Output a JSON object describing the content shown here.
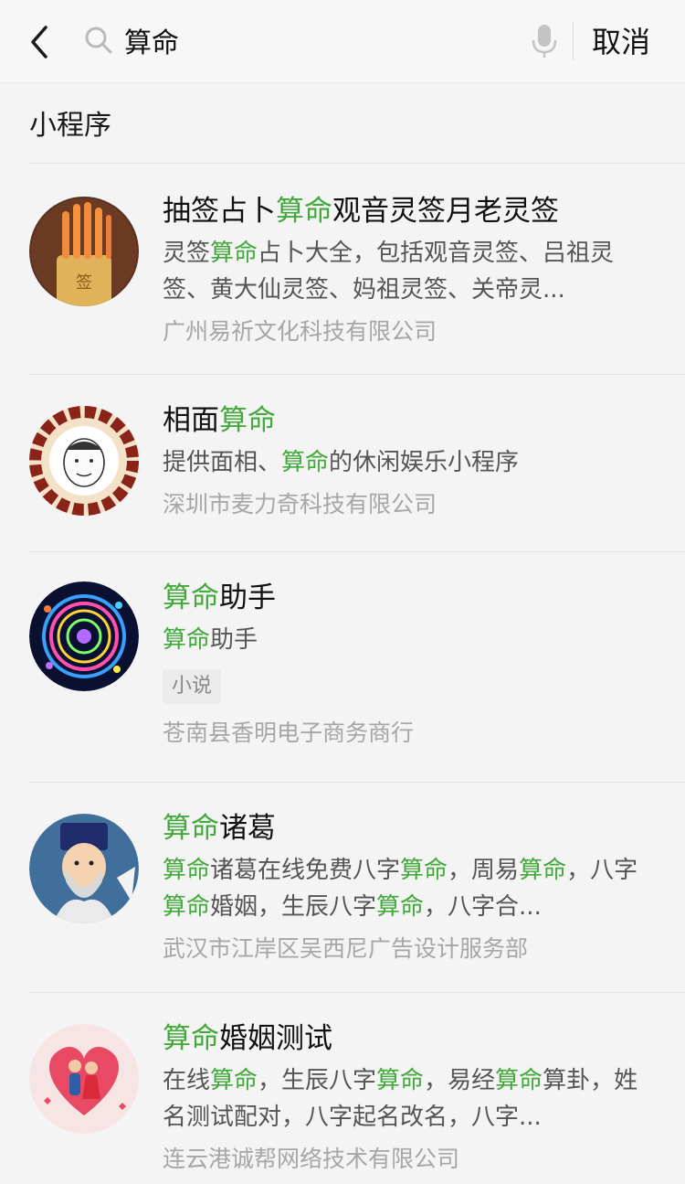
{
  "header": {
    "search_value": "算命",
    "cancel_label": "取消",
    "icons": [
      "back-chevron-icon",
      "search-icon",
      "microphone-icon"
    ]
  },
  "section": {
    "title": "小程序"
  },
  "colors": {
    "highlight": "#43a93c",
    "company": "#a6a6a6",
    "background": "#f5f4f4"
  },
  "results": [
    {
      "title_parts": [
        "抽签占卜",
        "算命",
        "观音灵签月老灵签"
      ],
      "desc_parts": [
        "灵签",
        "算命",
        "占卜大全，包括观音灵签、吕祖灵签、黄大仙灵签、妈祖灵签、关帝灵..."
      ],
      "company": "广州易祈文化科技有限公司",
      "avatar": "fortune-sticks-avatar"
    },
    {
      "title_parts": [
        "相面",
        "算命"
      ],
      "desc_parts": [
        "提供面相、",
        "算命",
        "的休闲娱乐小程序"
      ],
      "company": "深圳市麦力奇科技有限公司",
      "avatar": "bagua-face-avatar"
    },
    {
      "title_parts": [
        "算命",
        "助手"
      ],
      "desc_parts": [
        "算命",
        "助手"
      ],
      "tag": "小说",
      "company": "苍南县香明电子商务商行",
      "avatar": "zodiac-wheel-avatar"
    },
    {
      "title_parts": [
        "算命",
        "诸葛"
      ],
      "desc_parts": [
        "算命",
        "诸葛在线免费八字",
        "算命",
        "，周易",
        "算命",
        "，八字",
        "算命",
        "婚姻，生辰八字",
        "算命",
        "，八字合..."
      ],
      "company": "武汉市江岸区吴西尼广告设计服务部",
      "avatar": "zhuge-cartoon-avatar"
    },
    {
      "title_parts": [
        "算命",
        "婚姻测试"
      ],
      "desc_parts": [
        "在线",
        "算命",
        "，生辰八字",
        "算命",
        "，易经",
        "算命",
        "算卦，姓名测试配对，八字起名改名，八字..."
      ],
      "company": "连云港诚帮网络技术有限公司",
      "avatar": "couple-heart-avatar"
    }
  ]
}
